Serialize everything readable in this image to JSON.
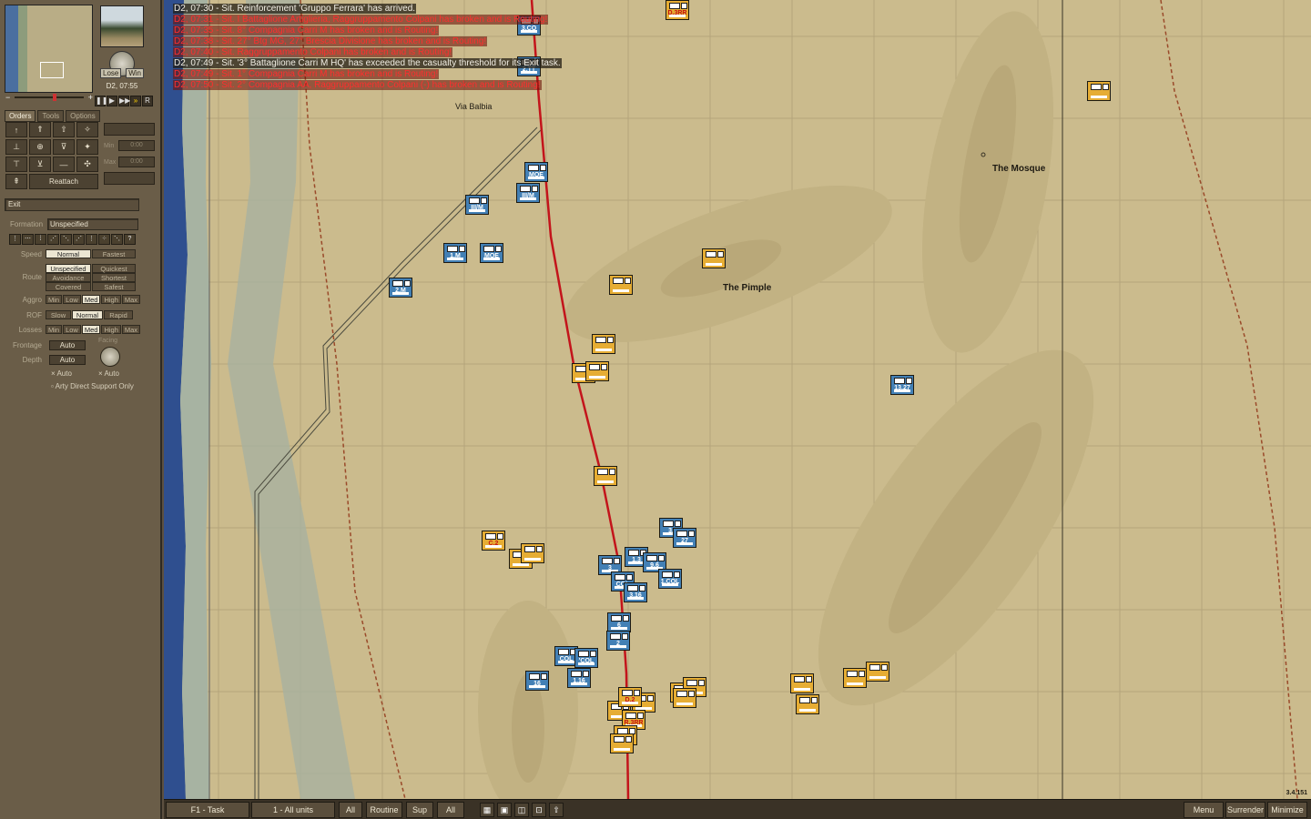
{
  "clock": "D2, 07:55",
  "gauge": {
    "lose": "Lose",
    "win": "Win"
  },
  "tabs": [
    {
      "label": "Orders",
      "active": true
    },
    {
      "label": "Tools",
      "active": false
    },
    {
      "label": "Options",
      "active": false
    }
  ],
  "orders": {
    "reattach": "Reattach",
    "side_labels": [
      "Min",
      "Max"
    ],
    "side_values": [
      "0:00",
      "0:00"
    ]
  },
  "task": "Exit",
  "formation": {
    "label": "Formation",
    "value": "Unspecified"
  },
  "speed": {
    "label": "Speed",
    "options": [
      "Normal",
      "Fastest"
    ],
    "selected": "Normal"
  },
  "route": {
    "label": "Route",
    "options": [
      "Unspecified",
      "Quickest",
      "Avoidance",
      "Shortest",
      "Covered",
      "Safest"
    ],
    "selected": "Unspecified"
  },
  "aggro": {
    "label": "Aggro",
    "options": [
      "Min",
      "Low",
      "Med",
      "High",
      "Max"
    ],
    "selected": "Med"
  },
  "rof": {
    "label": "ROF",
    "options": [
      "Slow",
      "Normal",
      "Rapid"
    ],
    "selected": "Normal"
  },
  "losses": {
    "label": "Losses",
    "options": [
      "Min",
      "Low",
      "Med",
      "High",
      "Max"
    ],
    "selected": "Med"
  },
  "frontage": {
    "label": "Frontage",
    "value": "Auto"
  },
  "depth": {
    "label": "Depth",
    "value": "Auto"
  },
  "facing": {
    "label": "Facing",
    "auto": "Auto"
  },
  "depth_auto_check": "Auto",
  "arty_direct": "Arty Direct Support Only",
  "messages": [
    {
      "text": "D2, 07:30 - Sit. Reinforcement 'Gruppo Ferrara' has arrived.",
      "color": "white"
    },
    {
      "text": "D2, 07:31 - Sit. I Battaglione Artiglieria, Raggruppamento Colpani has broken and is Routing!",
      "color": "red"
    },
    {
      "text": "D2, 07:35 - Sit. 8° Compagnia Carri M has broken and is Routing!",
      "color": "red"
    },
    {
      "text": "D2, 07:38 - Sit. 27° Btg MG, 27° Brescia Divisione has broken and is Routing!",
      "color": "red"
    },
    {
      "text": "D2, 07:40 - Sit. Raggruppamento Colpani has broken and is Routing!",
      "color": "red"
    },
    {
      "text": "D2, 07:49 - Sit. '3° Battaglione Carri M HQ' has exceeded the casualty threshold for its Exit task.",
      "color": "white"
    },
    {
      "text": "D2, 07:49 - Sit. 1° Compagnia Carri M has broken and is Routing!",
      "color": "red"
    },
    {
      "text": "D2, 07:50 - Sit. 2° Compagnia AA, Raggruppamento Colpani (-) has broken and is Routing!",
      "color": "red"
    }
  ],
  "places": {
    "via_balbia": "Via Balbia",
    "mosque": "The Mosque",
    "pimple": "The Pimple"
  },
  "units": [
    {
      "side": "gb",
      "label": "3.CO"
    },
    {
      "side": "gb",
      "label": "2.TT"
    },
    {
      "side": "it",
      "label": "D.3RR"
    },
    {
      "side": "it",
      "label": ""
    },
    {
      "side": "gb",
      "label": "MOE"
    },
    {
      "side": "gb",
      "label": "III/M"
    },
    {
      "side": "gb",
      "label": "III/M"
    },
    {
      "side": "gb",
      "label": "1.M"
    },
    {
      "side": "gb",
      "label": "MOE"
    },
    {
      "side": "gb",
      "label": "2.M"
    },
    {
      "side": "it",
      "label": ""
    },
    {
      "side": "it",
      "label": ""
    },
    {
      "side": "it",
      "label": ""
    },
    {
      "side": "it",
      "label": ""
    },
    {
      "side": "it",
      "label": ""
    },
    {
      "side": "gb",
      "label": "13.27"
    },
    {
      "side": "it",
      "label": ""
    },
    {
      "side": "it",
      "label": "C.2"
    },
    {
      "side": "it",
      "label": ""
    },
    {
      "side": "it",
      "label": ""
    },
    {
      "side": "gb",
      "label": "3."
    },
    {
      "side": "gb",
      "label": "27"
    },
    {
      "side": "gb",
      "label": "1.3"
    },
    {
      "side": "gb",
      "label": "3"
    },
    {
      "side": "gb",
      "label": "9.6"
    },
    {
      "side": "gb",
      "label": "COL"
    },
    {
      "side": "gb",
      "label": "1.COL"
    },
    {
      "side": "gb",
      "label": "3.16"
    },
    {
      "side": "gb",
      "label": "6"
    },
    {
      "side": "gb",
      "label": "2"
    },
    {
      "side": "gb",
      "label": "COL"
    },
    {
      "side": "gb",
      "label": "'COL"
    },
    {
      "side": "gb",
      "label": "16"
    },
    {
      "side": "gb",
      "label": "1.16"
    },
    {
      "side": "it",
      "label": ""
    },
    {
      "side": "it",
      "label": ""
    },
    {
      "side": "it",
      "label": ""
    },
    {
      "side": "it",
      "label": ""
    },
    {
      "side": "it",
      "label": ""
    },
    {
      "side": "it",
      "label": ""
    },
    {
      "side": "it",
      "label": ""
    },
    {
      "side": "it",
      "label": ""
    },
    {
      "side": "it",
      "label": ""
    },
    {
      "side": "it",
      "label": "D.2"
    },
    {
      "side": "it",
      "label": "R.3RR"
    },
    {
      "side": "it",
      "label": ""
    },
    {
      "side": "it",
      "label": ""
    }
  ],
  "bottom": {
    "task_btn": "F1 - Task",
    "units_btn": "1 - All units",
    "all1": "All",
    "routine": "Routine",
    "sup": "Sup",
    "all2": "All",
    "menu": "Menu",
    "surrender": "Surrender",
    "minimize": "Minimize"
  },
  "version": "3.4.151"
}
